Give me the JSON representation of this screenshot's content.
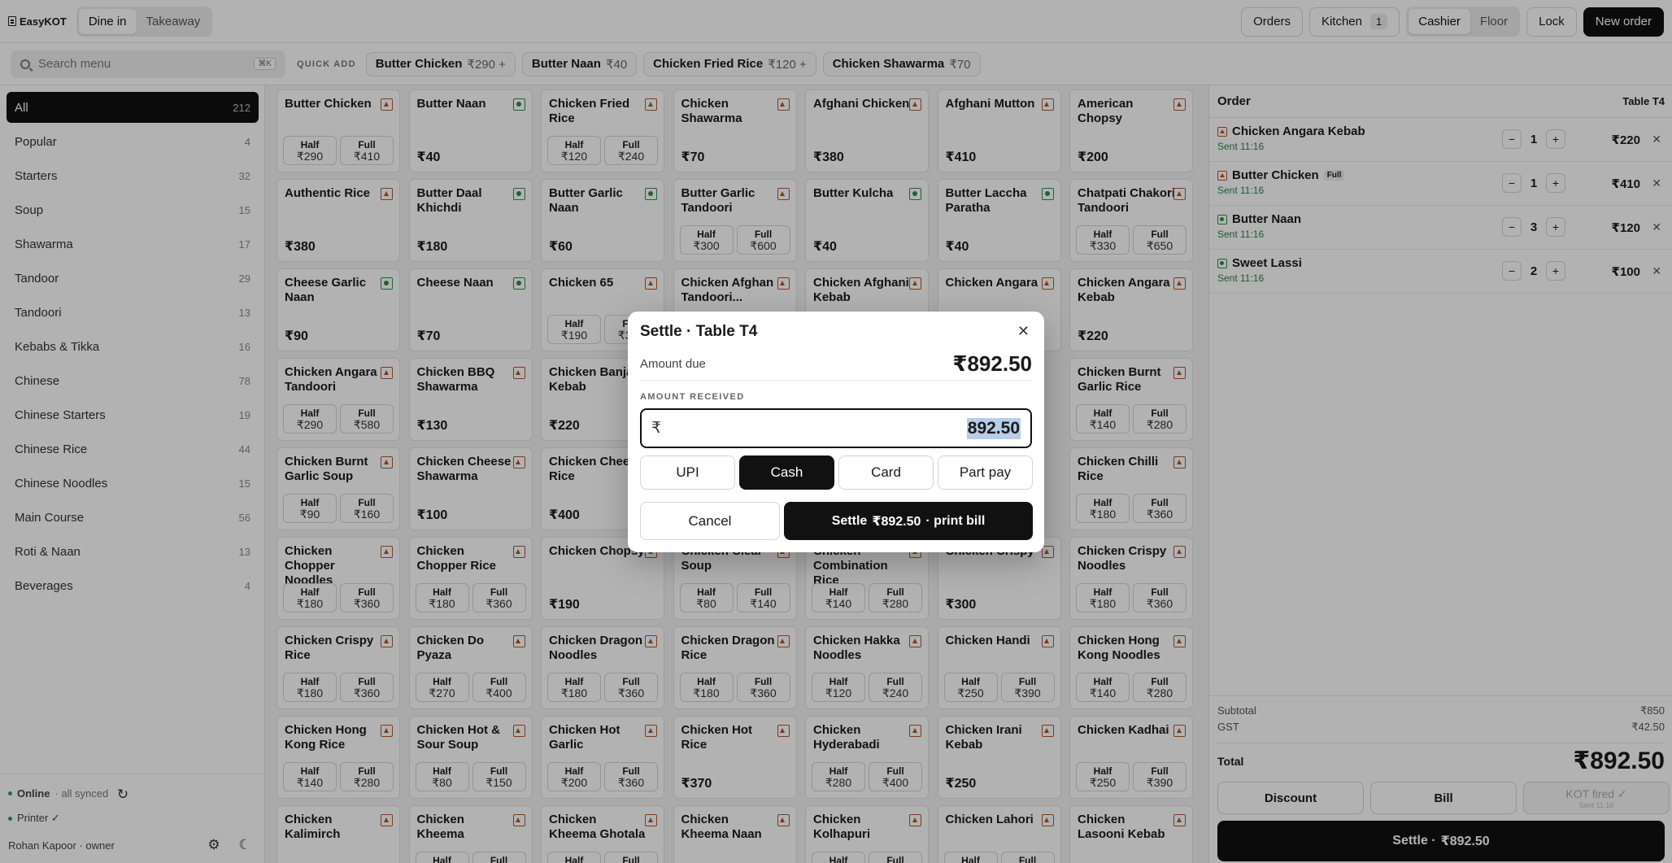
{
  "app": {
    "name": "EasyKOT"
  },
  "header": {
    "modes": [
      "Dine in",
      "Takeaway"
    ],
    "active_mode": "Dine in",
    "orders_label": "Orders",
    "kitchen_label": "Kitchen",
    "kitchen_count": "1",
    "roles": [
      "Cashier",
      "Floor"
    ],
    "lock_label": "Lock",
    "new_order_label": "New order"
  },
  "search": {
    "placeholder": "Search menu",
    "shortcut": "⌘K"
  },
  "quick_add": {
    "label": "QUICK ADD",
    "items": [
      {
        "name": "Butter Chicken",
        "price": "₹290 +"
      },
      {
        "name": "Butter Naan",
        "price": "₹40"
      },
      {
        "name": "Chicken Fried Rice",
        "price": "₹120 +"
      },
      {
        "name": "Chicken Shawarma",
        "price": "₹70"
      }
    ]
  },
  "categories": [
    {
      "name": "All",
      "count": "212",
      "active": true
    },
    {
      "name": "Popular",
      "count": "4"
    },
    {
      "name": "Starters",
      "count": "32"
    },
    {
      "name": "Soup",
      "count": "15"
    },
    {
      "name": "Shawarma",
      "count": "17"
    },
    {
      "name": "Tandoor",
      "count": "29"
    },
    {
      "name": "Tandoori",
      "count": "13"
    },
    {
      "name": "Kebabs & Tikka",
      "count": "16"
    },
    {
      "name": "Chinese",
      "count": "78"
    },
    {
      "name": "Chinese Starters",
      "count": "19"
    },
    {
      "name": "Chinese Rice",
      "count": "44"
    },
    {
      "name": "Chinese Noodles",
      "count": "15"
    },
    {
      "name": "Main Course",
      "count": "56"
    },
    {
      "name": "Roti & Naan",
      "count": "13"
    },
    {
      "name": "Beverages",
      "count": "4"
    }
  ],
  "sidebar_footer": {
    "status": "Online",
    "sync": "· all synced",
    "printer": "Printer ✓",
    "user": "Rohan Kapoor · owner"
  },
  "menu_items": [
    {
      "name": "Butter Chicken",
      "veg": false,
      "half": "₹290",
      "full": "₹410"
    },
    {
      "name": "Butter Naan",
      "veg": true,
      "price": "₹40"
    },
    {
      "name": "Chicken Fried Rice",
      "veg": false,
      "half": "₹120",
      "full": "₹240"
    },
    {
      "name": "Chicken Shawarma",
      "veg": false,
      "price": "₹70"
    },
    {
      "name": "Afghani Chicken",
      "veg": false,
      "price": "₹380"
    },
    {
      "name": "Afghani Mutton",
      "veg": false,
      "price": "₹410"
    },
    {
      "name": "American Chopsy",
      "veg": false,
      "price": "₹200"
    },
    {
      "name": "Authentic Rice",
      "veg": false,
      "price": "₹380"
    },
    {
      "name": "Butter Daal Khichdi",
      "veg": true,
      "price": "₹180"
    },
    {
      "name": "Butter Garlic Naan",
      "veg": true,
      "price": "₹60"
    },
    {
      "name": "Butter Garlic Tandoori",
      "veg": false,
      "half": "₹300",
      "full": "₹600"
    },
    {
      "name": "Butter Kulcha",
      "veg": true,
      "price": "₹40"
    },
    {
      "name": "Butter Laccha Paratha",
      "veg": true,
      "price": "₹40"
    },
    {
      "name": "Chatpati Chakori Tandoori",
      "veg": false,
      "half": "₹330",
      "full": "₹650"
    },
    {
      "name": "Cheese Garlic Naan",
      "veg": true,
      "price": "₹90"
    },
    {
      "name": "Cheese Naan",
      "veg": true,
      "price": "₹70"
    },
    {
      "name": "Chicken 65",
      "veg": false,
      "half": "₹190",
      "full": "₹380"
    },
    {
      "name": "Chicken Afghan Tandoori...",
      "veg": false,
      "price": ""
    },
    {
      "name": "Chicken Afghani Kebab",
      "veg": false,
      "price": ""
    },
    {
      "name": "Chicken Angara",
      "veg": false,
      "price": ""
    },
    {
      "name": "Chicken Angara Kebab",
      "veg": false,
      "price": "₹220"
    },
    {
      "name": "Chicken Angara Tandoori",
      "veg": false,
      "half": "₹290",
      "full": "₹580"
    },
    {
      "name": "Chicken BBQ Shawarma",
      "veg": false,
      "price": "₹130"
    },
    {
      "name": "Chicken Banjara Kebab",
      "veg": false,
      "price": "₹220"
    },
    {
      "name": "",
      "veg": false,
      "price": ""
    },
    {
      "name": "",
      "veg": false,
      "price": ""
    },
    {
      "name": "",
      "veg": false,
      "price": ""
    },
    {
      "name": "Chicken Burnt Garlic Rice",
      "veg": false,
      "half": "₹140",
      "full": "₹280"
    },
    {
      "name": "Chicken Burnt Garlic Soup",
      "veg": false,
      "half": "₹90",
      "full": "₹160"
    },
    {
      "name": "Chicken Cheese Shawarma",
      "veg": false,
      "price": "₹100"
    },
    {
      "name": "Chicken Cheese Rice",
      "veg": false,
      "price": "₹400"
    },
    {
      "name": "",
      "veg": false,
      "price": ""
    },
    {
      "name": "",
      "veg": false,
      "price": ""
    },
    {
      "name": "",
      "veg": false,
      "price": ""
    },
    {
      "name": "Chicken Chilli Rice",
      "veg": false,
      "half": "₹180",
      "full": "₹360"
    },
    {
      "name": "Chicken Chopper Noodles",
      "veg": false,
      "half": "₹180",
      "full": "₹360"
    },
    {
      "name": "Chicken Chopper Rice",
      "veg": false,
      "half": "₹180",
      "full": "₹360"
    },
    {
      "name": "Chicken Chopsy",
      "veg": false,
      "price": "₹190"
    },
    {
      "name": "Chicken Clear Soup",
      "veg": false,
      "half": "₹80",
      "full": "₹140"
    },
    {
      "name": "Chicken Combination Rice",
      "veg": false,
      "half": "₹140",
      "full": "₹280"
    },
    {
      "name": "Chicken Crispy",
      "veg": false,
      "price": "₹300"
    },
    {
      "name": "Chicken Crispy Noodles",
      "veg": false,
      "half": "₹180",
      "full": "₹360"
    },
    {
      "name": "Chicken Crispy Rice",
      "veg": false,
      "half": "₹180",
      "full": "₹360"
    },
    {
      "name": "Chicken Do Pyaza",
      "veg": false,
      "half": "₹270",
      "full": "₹400"
    },
    {
      "name": "Chicken Dragon Noodles",
      "veg": false,
      "half": "₹180",
      "full": "₹360"
    },
    {
      "name": "Chicken Dragon Rice",
      "veg": false,
      "half": "₹180",
      "full": "₹360"
    },
    {
      "name": "Chicken Hakka Noodles",
      "veg": false,
      "half": "₹120",
      "full": "₹240"
    },
    {
      "name": "Chicken Handi",
      "veg": false,
      "half": "₹250",
      "full": "₹390"
    },
    {
      "name": "Chicken Hong Kong Noodles",
      "veg": false,
      "half": "₹140",
      "full": "₹280"
    },
    {
      "name": "Chicken Hong Kong Rice",
      "veg": false,
      "half": "₹140",
      "full": "₹280"
    },
    {
      "name": "Chicken Hot & Sour Soup",
      "veg": false,
      "half": "₹80",
      "full": "₹150"
    },
    {
      "name": "Chicken Hot Garlic",
      "veg": false,
      "half": "₹200",
      "full": "₹360"
    },
    {
      "name": "Chicken Hot Rice",
      "veg": false,
      "price": "₹370"
    },
    {
      "name": "Chicken Hyderabadi",
      "veg": false,
      "half": "₹280",
      "full": "₹400"
    },
    {
      "name": "Chicken Irani Kebab",
      "veg": false,
      "price": "₹250"
    },
    {
      "name": "Chicken Kadhai",
      "veg": false,
      "half": "₹250",
      "full": "₹390"
    },
    {
      "name": "Chicken Kalimirch",
      "veg": false,
      "price": ""
    },
    {
      "name": "Chicken Kheema",
      "veg": false,
      "half": "",
      "full": ""
    },
    {
      "name": "Chicken Kheema Ghotala",
      "veg": false,
      "half": "",
      "full": ""
    },
    {
      "name": "Chicken Kheema Naan",
      "veg": false,
      "price": ""
    },
    {
      "name": "Chicken Kolhapuri",
      "veg": false,
      "half": "",
      "full": ""
    },
    {
      "name": "Chicken Lahori",
      "veg": false,
      "half": "",
      "full": ""
    },
    {
      "name": "Chicken Lasooni Kebab",
      "veg": false,
      "price": ""
    }
  ],
  "variant_labels": {
    "half": "Half",
    "full": "Full"
  },
  "order": {
    "title": "Order",
    "table": "Table T4",
    "lines": [
      {
        "name": "Chicken Angara Kebab",
        "veg": false,
        "tag": "",
        "sent": "Sent 11:16",
        "qty": "1",
        "price": "₹220"
      },
      {
        "name": "Butter Chicken",
        "veg": false,
        "tag": "Full",
        "sent": "Sent 11:16",
        "qty": "1",
        "price": "₹410"
      },
      {
        "name": "Butter Naan",
        "veg": true,
        "tag": "",
        "sent": "Sent 11:16",
        "qty": "3",
        "price": "₹120"
      },
      {
        "name": "Sweet Lassi",
        "veg": true,
        "tag": "",
        "sent": "Sent 11:16",
        "qty": "2",
        "price": "₹100"
      }
    ],
    "subtotal_label": "Subtotal",
    "subtotal": "₹850",
    "gst_label": "GST",
    "gst": "₹42.50",
    "total_label": "Total",
    "total": "₹892.50",
    "discount_label": "Discount",
    "bill_label": "Bill",
    "kot_label": "KOT fired ✓",
    "kot_sent": "Sent 11:16",
    "settle_label": "Settle ·",
    "settle_amount": "₹892.50"
  },
  "modal": {
    "title": "Settle · Table T4",
    "amount_due_label": "Amount due",
    "amount_due": "₹892.50",
    "received_label": "AMOUNT RECEIVED",
    "currency": "₹",
    "received_value": "892.50",
    "methods": [
      "UPI",
      "Cash",
      "Card",
      "Part pay"
    ],
    "active_method": "Cash",
    "cancel_label": "Cancel",
    "settle_label": "Settle",
    "settle_amount": "₹892.50",
    "settle_suffix": "· print bill"
  }
}
